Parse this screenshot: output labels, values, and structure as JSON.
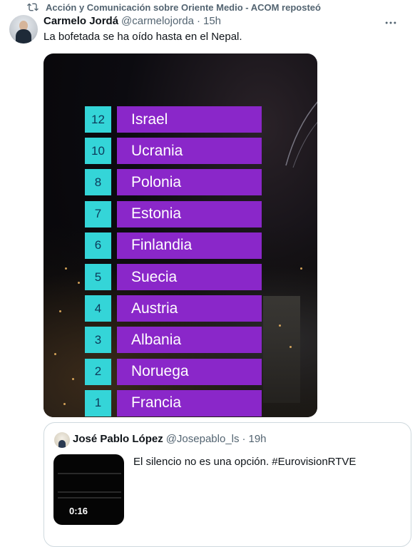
{
  "repost_banner": {
    "text": "Acción y Comunicación sobre Oriente Medio - ACOM reposteó",
    "icon": "repost-icon"
  },
  "tweet": {
    "author_name": "Carmelo Jordá",
    "author_handle": "@carmelojorda",
    "separator": "·",
    "time": "15h",
    "text": "La bofetada se ha oído hasta en el Nepal.",
    "more_icon": "more-icon",
    "media": {
      "rows": [
        {
          "points": "12",
          "country": "Israel"
        },
        {
          "points": "10",
          "country": "Ucrania"
        },
        {
          "points": "8",
          "country": "Polonia"
        },
        {
          "points": "7",
          "country": "Estonia"
        },
        {
          "points": "6",
          "country": "Finlandia"
        },
        {
          "points": "5",
          "country": "Suecia"
        },
        {
          "points": "4",
          "country": "Austria"
        },
        {
          "points": "3",
          "country": "Albania"
        },
        {
          "points": "2",
          "country": "Noruega"
        },
        {
          "points": "1",
          "country": "Francia"
        }
      ]
    }
  },
  "quoted": {
    "author_name": "José Pablo López",
    "author_handle": "@Josepablo_ls",
    "separator": "·",
    "time": "19h",
    "text": "El silencio no es una opción. #EurovisionRTVE",
    "video_duration": "0:16"
  },
  "colors": {
    "points_box": "#34d5d8",
    "country_box": "#8a27c9",
    "muted_text": "#536471",
    "border": "#cfd9de"
  }
}
